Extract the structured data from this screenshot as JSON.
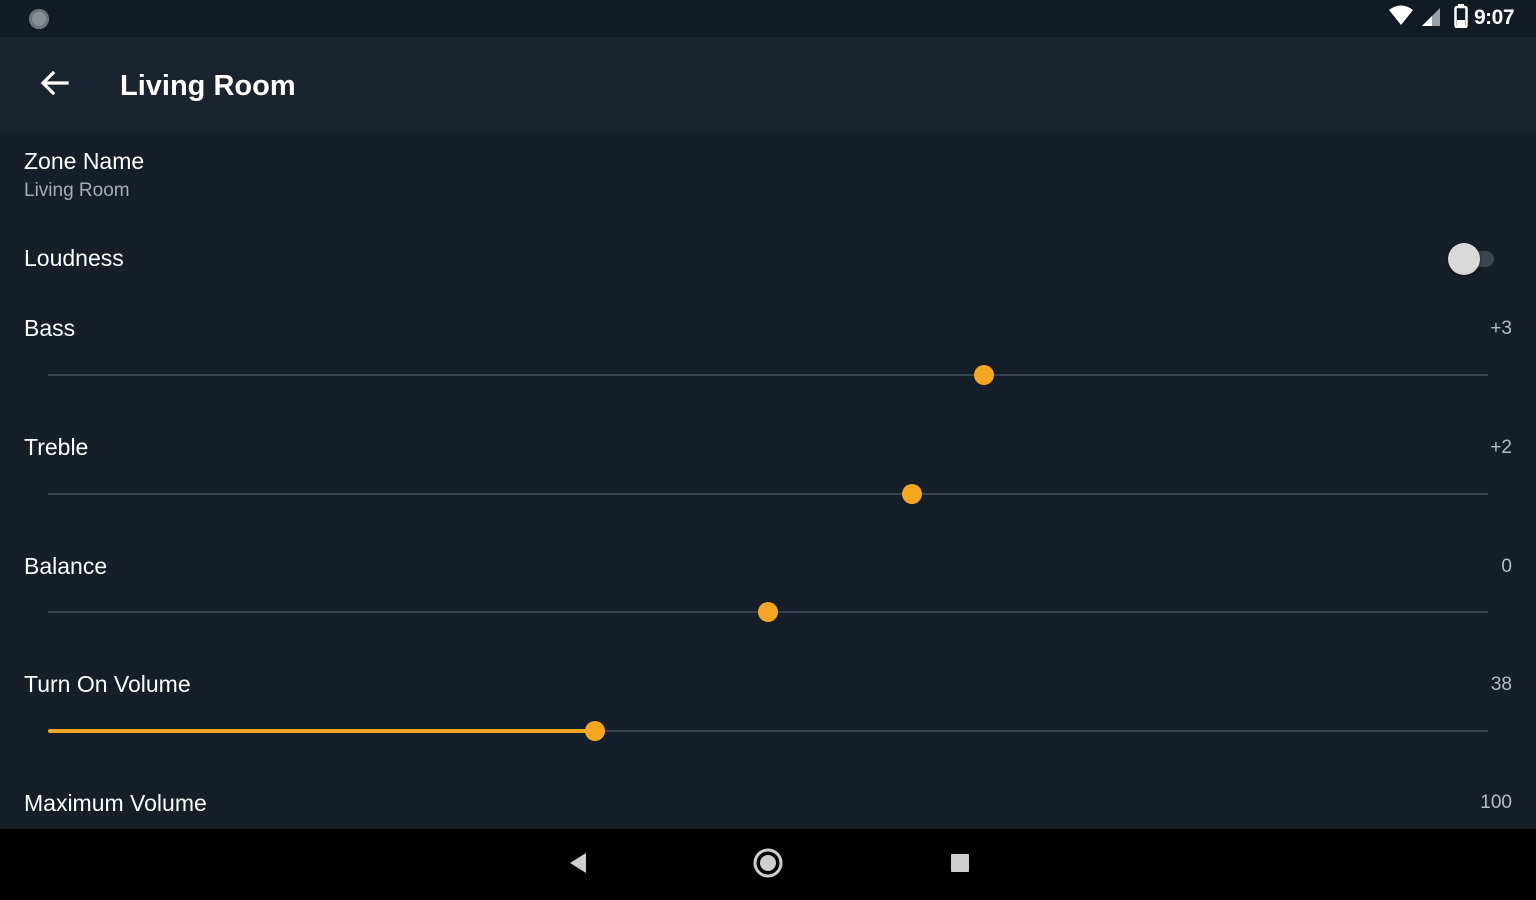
{
  "status_bar": {
    "time": "9:07",
    "icons": [
      "notification-dot-icon",
      "wifi-icon",
      "signal-icon",
      "battery-icon"
    ]
  },
  "app_bar": {
    "title": "Living Room",
    "back_icon": "arrow-back-icon"
  },
  "preferences": {
    "zone_name": {
      "title": "Zone Name",
      "summary": "Living Room"
    },
    "loudness": {
      "title": "Loudness",
      "enabled": false
    },
    "bass": {
      "title": "Bass",
      "value": "+3",
      "position": 0.65
    },
    "treble": {
      "title": "Treble",
      "value": "+2",
      "position": 0.6
    },
    "balance": {
      "title": "Balance",
      "value": "0",
      "position": 0.5
    },
    "turn_on_volume": {
      "title": "Turn On Volume",
      "value": "38",
      "position": 0.38,
      "filled": true
    },
    "maximum_volume": {
      "title": "Maximum Volume",
      "value": "100"
    }
  },
  "colors": {
    "accent": "#f5a623",
    "background": "#151e29",
    "app_bar": "#1a2430"
  },
  "nav_bar": {
    "icons": [
      "nav-back-icon",
      "nav-home-icon",
      "nav-recents-icon"
    ]
  }
}
